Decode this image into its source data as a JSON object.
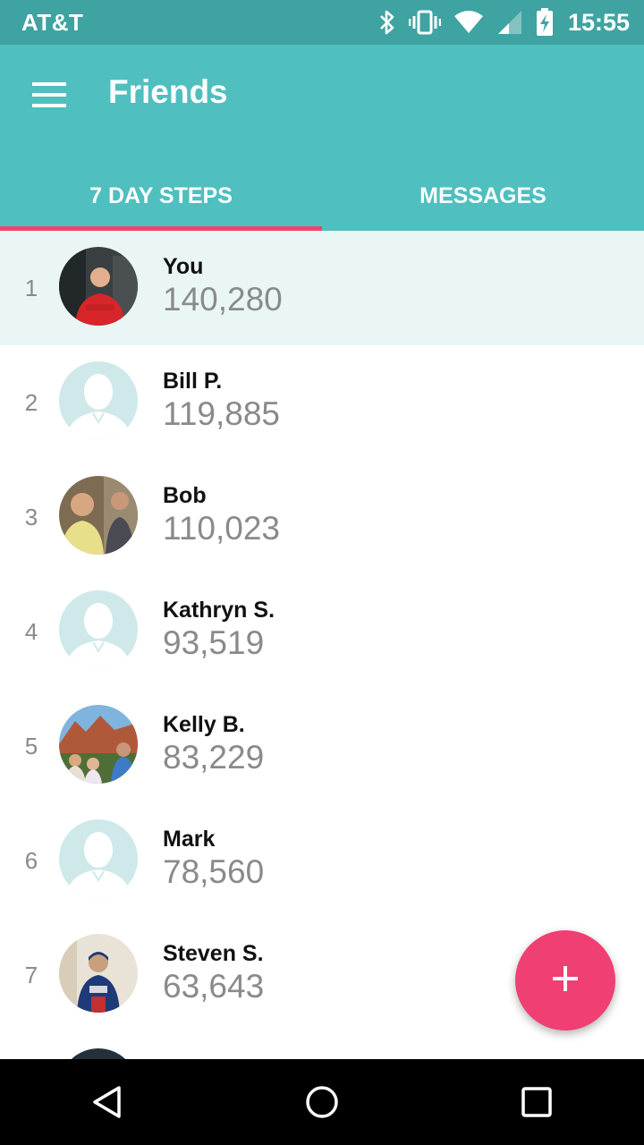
{
  "status_bar": {
    "carrier": "AT&T",
    "time": "15:55",
    "icons": [
      "bluetooth-icon",
      "vibrate-icon",
      "wifi-icon",
      "signal-icon",
      "battery-charging-icon"
    ]
  },
  "header": {
    "title": "Friends",
    "menu_icon": "hamburger-menu-icon"
  },
  "tabs": [
    {
      "label": "7 DAY STEPS",
      "active": true
    },
    {
      "label": "MESSAGES",
      "active": false
    }
  ],
  "leaderboard": [
    {
      "rank": "1",
      "name": "You",
      "steps": "140,280",
      "avatar": "photo"
    },
    {
      "rank": "2",
      "name": "Bill P.",
      "steps": "119,885",
      "avatar": "default"
    },
    {
      "rank": "3",
      "name": "Bob",
      "steps": "110,023",
      "avatar": "photo"
    },
    {
      "rank": "4",
      "name": "Kathryn S.",
      "steps": "93,519",
      "avatar": "default"
    },
    {
      "rank": "5",
      "name": "Kelly B.",
      "steps": "83,229",
      "avatar": "photo"
    },
    {
      "rank": "6",
      "name": "Mark",
      "steps": "78,560",
      "avatar": "default"
    },
    {
      "rank": "7",
      "name": "Steven S.",
      "steps": "63,643",
      "avatar": "photo"
    }
  ],
  "fab": {
    "icon": "plus-icon"
  },
  "nav": {
    "icons": [
      "back-icon",
      "home-icon",
      "recents-icon"
    ]
  },
  "colors": {
    "status_bar": "#3fa3a1",
    "app_bar": "#4fbfbf",
    "accent": "#ef3f73",
    "highlight_row": "#eaf6f6"
  }
}
